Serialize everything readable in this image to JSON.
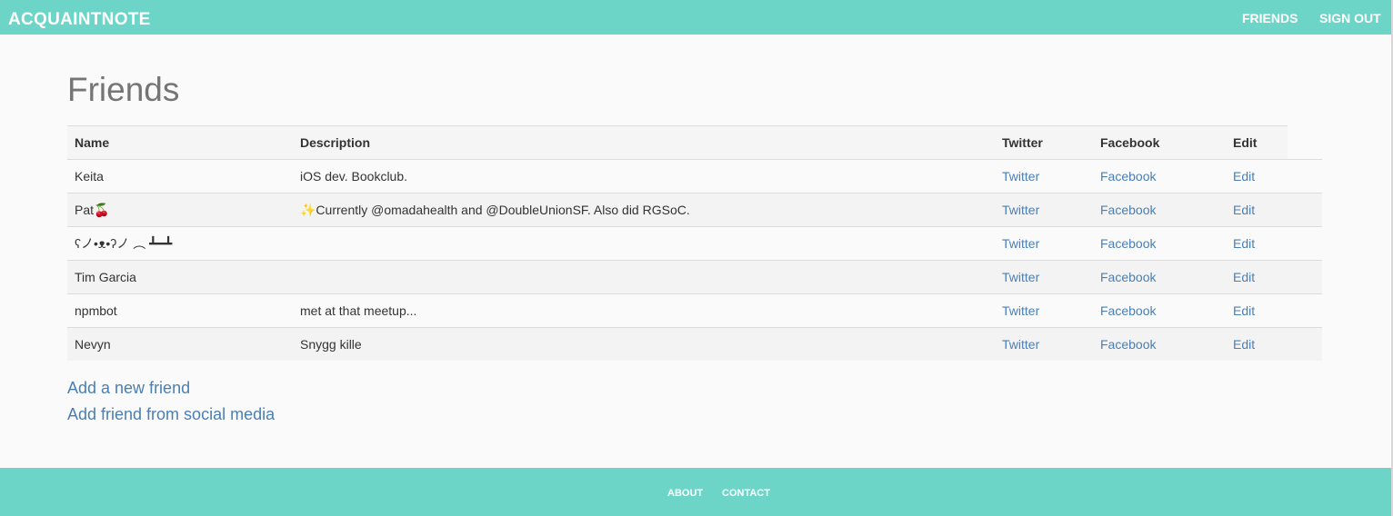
{
  "navbar": {
    "brand": "ACQUAINTNOTE",
    "links": {
      "friends": "FRIENDS",
      "sign_out": "SIGN OUT"
    }
  },
  "main": {
    "title": "Friends",
    "table": {
      "headers": {
        "name": "Name",
        "description": "Description",
        "twitter": "Twitter",
        "facebook": "Facebook",
        "edit": "Edit"
      },
      "rows": [
        {
          "name": "Keita",
          "description": "iOS dev. Bookclub.",
          "twitter": "Twitter",
          "facebook": "Facebook",
          "edit": "Edit"
        },
        {
          "name": "Pat🍒",
          "description": "✨Currently @omadahealth and @DoubleUnionSF. Also did RGSoC.",
          "twitter": "Twitter",
          "facebook": "Facebook",
          "edit": "Edit"
        },
        {
          "name": "ʕノ•ᴥ•ʔノ ︵ ┻━┻",
          "description": "",
          "twitter": "Twitter",
          "facebook": "Facebook",
          "edit": "Edit"
        },
        {
          "name": "Tim Garcia",
          "description": "",
          "twitter": "Twitter",
          "facebook": "Facebook",
          "edit": "Edit"
        },
        {
          "name": "npmbot",
          "description": "met at that meetup...",
          "twitter": "Twitter",
          "facebook": "Facebook",
          "edit": "Edit"
        },
        {
          "name": "Nevyn",
          "description": "Snygg kille",
          "twitter": "Twitter",
          "facebook": "Facebook",
          "edit": "Edit"
        }
      ]
    },
    "actions": {
      "add_new": "Add a new friend",
      "add_social": "Add friend from social media"
    }
  },
  "footer": {
    "about": "ABOUT",
    "contact": "CONTACT"
  },
  "colors": {
    "accent": "#6dd5c7",
    "link": "#4a7fb5",
    "title": "#757575"
  }
}
